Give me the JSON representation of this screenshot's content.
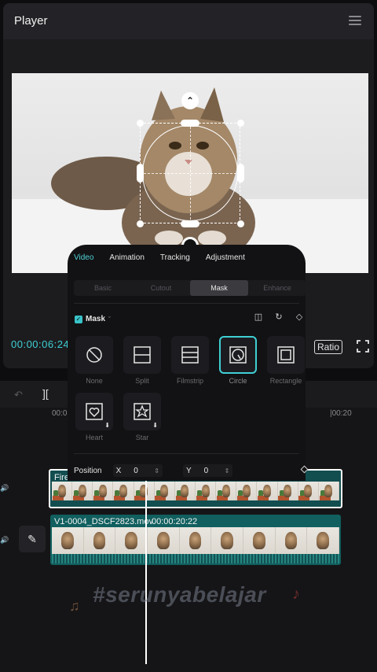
{
  "player": {
    "title": "Player",
    "timecode": "00:00:06:24",
    "ratio_label": "Ratio"
  },
  "panel": {
    "tabs": [
      {
        "label": "Video",
        "active": true
      },
      {
        "label": "Animation",
        "active": false
      },
      {
        "label": "Tracking",
        "active": false
      },
      {
        "label": "Adjustment",
        "active": false
      }
    ],
    "sub_tabs": [
      {
        "label": "Basic",
        "active": false
      },
      {
        "label": "Cutout",
        "active": false
      },
      {
        "label": "Mask",
        "active": true
      },
      {
        "label": "Enhance",
        "active": false
      }
    ],
    "mask_toggle_label": "Mask",
    "mask_enabled": true,
    "shapes": [
      {
        "label": "None",
        "icon": "none-icon",
        "selected": false
      },
      {
        "label": "Split",
        "icon": "split-mask-icon",
        "selected": false
      },
      {
        "label": "Filmstrip",
        "icon": "filmstrip-mask-icon",
        "selected": false
      },
      {
        "label": "Circle",
        "icon": "circle-mask-icon",
        "selected": true
      },
      {
        "label": "Rectangle",
        "icon": "rectangle-mask-icon",
        "selected": false
      },
      {
        "label": "Heart",
        "icon": "heart-mask-icon",
        "selected": false,
        "download": true
      },
      {
        "label": "Star",
        "icon": "star-mask-icon",
        "selected": false,
        "download": true
      }
    ],
    "position": {
      "label": "Position",
      "x_label": "X",
      "x_value": "0",
      "y_label": "Y",
      "y_value": "0"
    }
  },
  "timeline": {
    "ruler": {
      "start": "00:0",
      "end": "00:20"
    },
    "top_clip": {
      "label": "Firef"
    },
    "bottom_clip": {
      "label": "V1-0004_DSCF2823.mov",
      "duration": "00:00:20:22"
    }
  },
  "watermark": "#serunyabelajar",
  "colors": {
    "accent": "#3fd0d4",
    "clip_teal": "#115f5f",
    "panel_bg": "#121214"
  }
}
